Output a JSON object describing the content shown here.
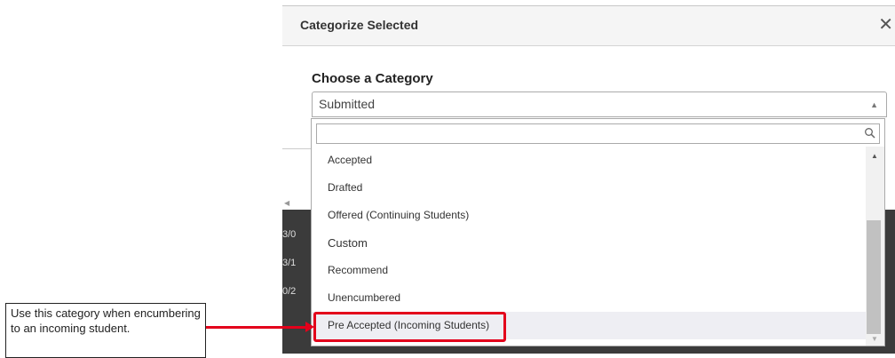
{
  "modal": {
    "title": "Categorize Selected",
    "close_symbol": "✕"
  },
  "form": {
    "label": "Choose a Category",
    "selected_value": "Submitted"
  },
  "dropdown": {
    "search_placeholder": "",
    "options": [
      {
        "label": "Accepted",
        "type": "option"
      },
      {
        "label": "Drafted",
        "type": "option"
      },
      {
        "label": "Offered (Continuing Students)",
        "type": "option"
      },
      {
        "label": "Custom",
        "type": "group"
      },
      {
        "label": "Recommend",
        "type": "option"
      },
      {
        "label": "Unencumbered",
        "type": "option"
      },
      {
        "label": "Pre Accepted (Incoming Students)",
        "type": "option",
        "highlighted": true
      }
    ]
  },
  "background_rows": [
    "3/0",
    "3/1",
    "0/2"
  ],
  "callout": {
    "text": "Use this category when encumbering to an incoming student."
  },
  "colors": {
    "highlight_border": "#e3001b",
    "dark_background": "#3b3b3b"
  }
}
